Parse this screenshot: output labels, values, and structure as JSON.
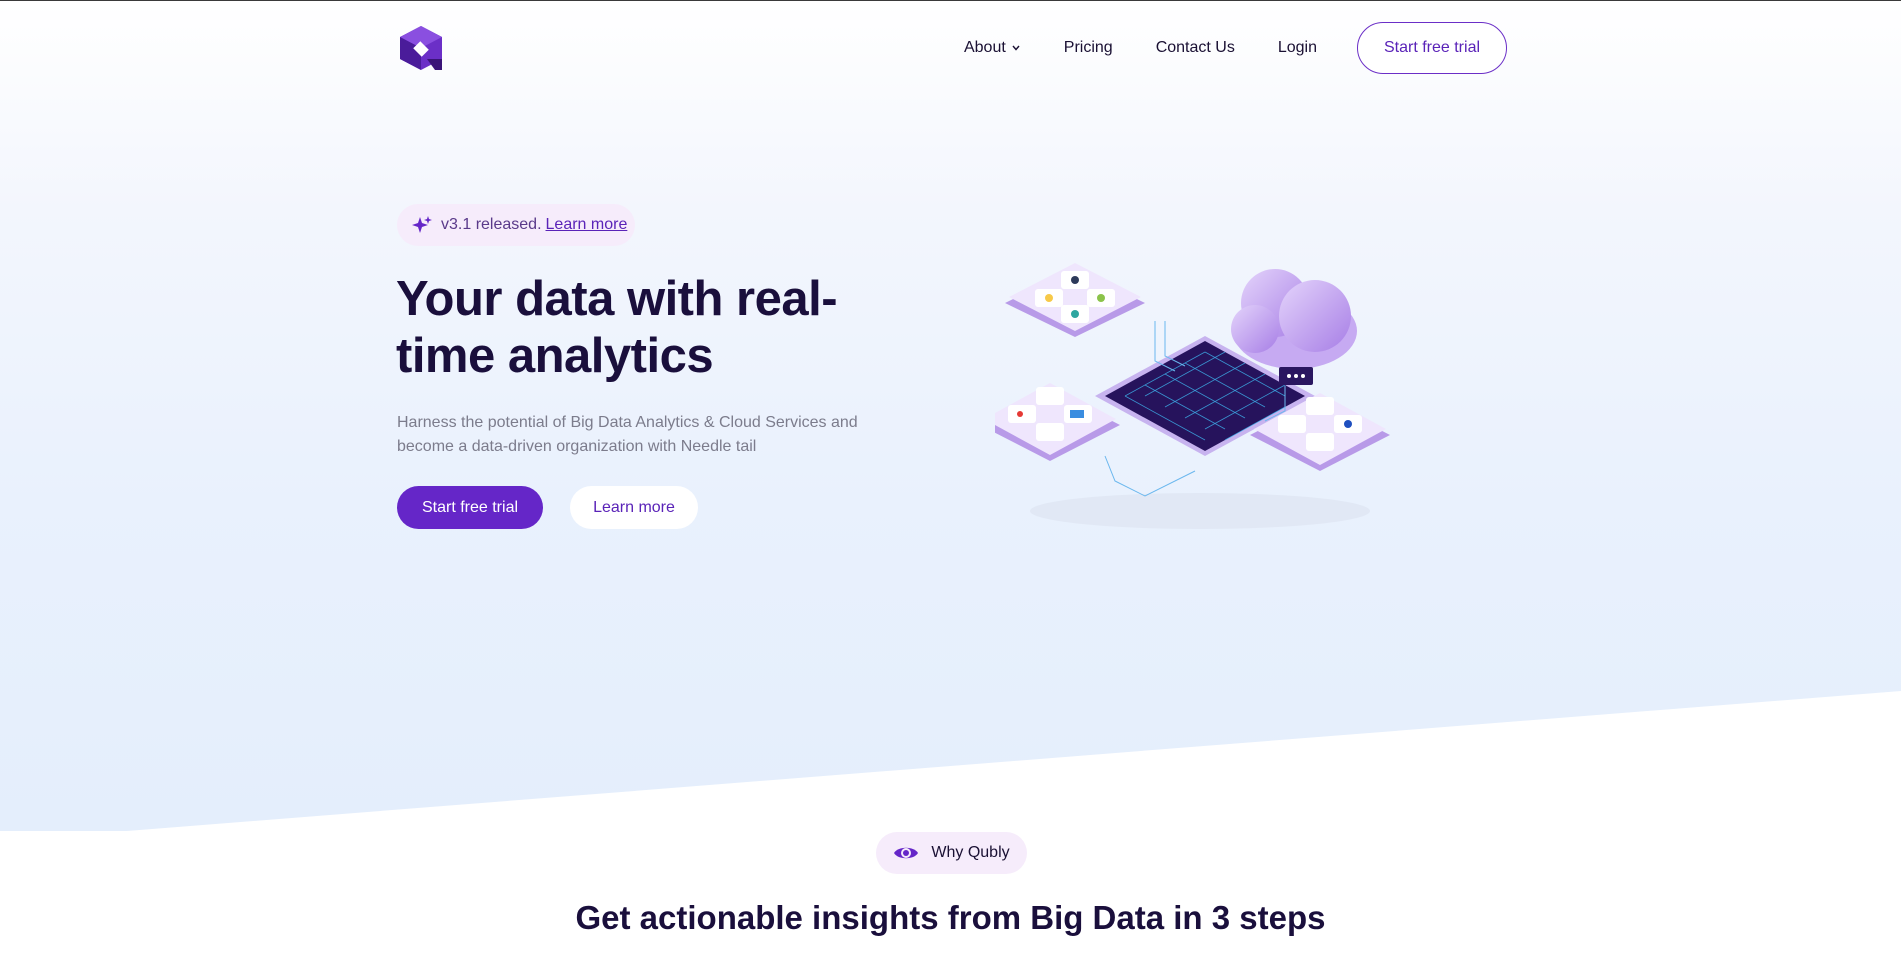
{
  "nav": {
    "items": [
      {
        "label": "About",
        "has_dropdown": true
      },
      {
        "label": "Pricing"
      },
      {
        "label": "Contact Us"
      },
      {
        "label": "Login"
      }
    ],
    "cta_label": "Start free trial"
  },
  "hero": {
    "badge_text": "v3.1 released.",
    "badge_link": "Learn more",
    "headline": "Your data with real-time analytics",
    "subtext": "Harness the potential of Big Data Analytics & Cloud Services and become a data-driven organization with Needle tail",
    "primary_button": "Start free trial",
    "secondary_button": "Learn more"
  },
  "section": {
    "badge": "Why Qubly",
    "title": "Get actionable insights from Big Data in 3 steps"
  },
  "colors": {
    "primary": "#6526c8",
    "heading": "#1a0f3c",
    "badge_bg": "#f6ecfb"
  }
}
